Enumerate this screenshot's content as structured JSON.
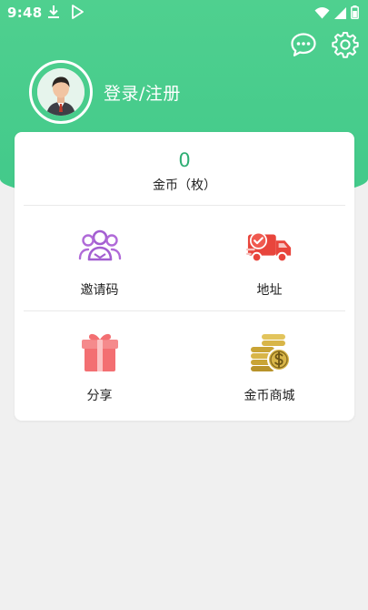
{
  "status_bar": {
    "time": "9:48",
    "icons": [
      "download-icon",
      "play-store-icon",
      "wifi-icon",
      "signal-icon",
      "battery-icon"
    ]
  },
  "header": {
    "background_color": "#4fd08f",
    "actions": [
      {
        "icon": "chat-bubble-icon"
      },
      {
        "icon": "settings-gear-icon"
      }
    ],
    "login_label": "登录/注册"
  },
  "coins": {
    "count": "0",
    "label": "金币（枚）",
    "count_color": "#2fae74"
  },
  "grid": [
    {
      "label": "邀请码",
      "icon": "users-icon",
      "icon_color": "#a35fd1"
    },
    {
      "label": "地址",
      "icon": "delivery-truck-icon",
      "icon_color": "#e8453c"
    },
    {
      "label": "分享",
      "icon": "gift-icon",
      "icon_color": "#f36f72"
    },
    {
      "label": "金币商城",
      "icon": "coin-stack-icon",
      "icon_color": "#c9a435"
    }
  ]
}
